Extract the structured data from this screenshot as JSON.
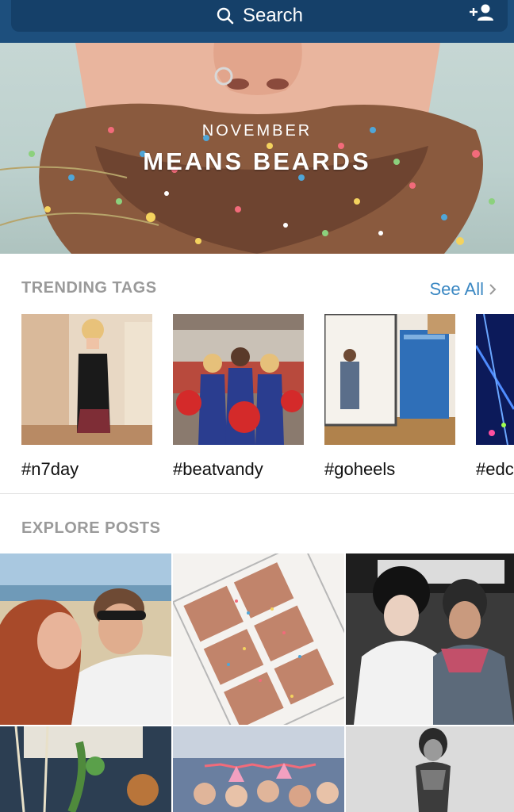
{
  "search": {
    "label": "Search"
  },
  "banner": {
    "subtitle": "NOVEMBER",
    "title": "MEANS BEARDS"
  },
  "trending": {
    "header": "TRENDING TAGS",
    "see_all": "See All",
    "tags": [
      {
        "label": "#n7day"
      },
      {
        "label": "#beatvandy"
      },
      {
        "label": "#goheels"
      },
      {
        "label": "#edc"
      }
    ]
  },
  "explore": {
    "header": "EXPLORE POSTS"
  },
  "colors": {
    "bar": "#1d4f7d",
    "accent": "#3b88c3",
    "section_text": "#9a9a9a"
  },
  "icons": [
    "search-icon",
    "add-user-icon",
    "chevron-right-icon"
  ]
}
